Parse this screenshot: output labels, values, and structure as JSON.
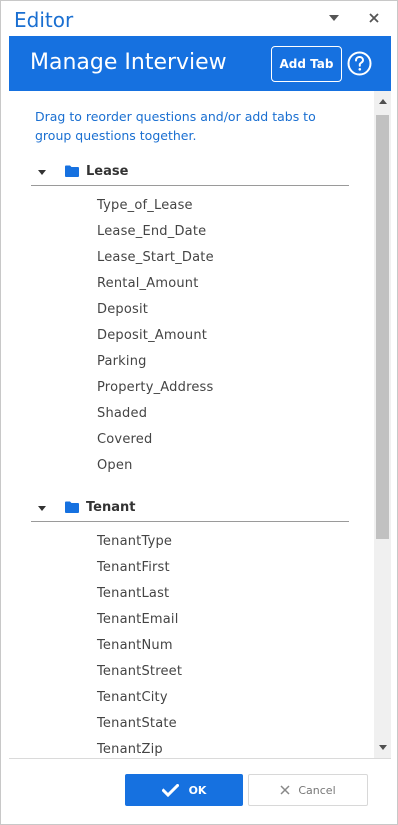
{
  "window": {
    "title": "Editor"
  },
  "header": {
    "title": "Manage Interview",
    "add_tab_label": "Add Tab"
  },
  "instructions": "Drag to reorder questions and/or add tabs to group questions together.",
  "groups": [
    {
      "name": "Lease",
      "items": [
        "Type_of_Lease",
        "Lease_End_Date",
        "Lease_Start_Date",
        "Rental_Amount",
        "Deposit",
        "Deposit_Amount",
        "Parking",
        "Property_Address",
        "Shaded",
        "Covered",
        "Open"
      ]
    },
    {
      "name": "Tenant",
      "items": [
        "TenantType",
        "TenantFirst",
        "TenantLast",
        "TenantEmail",
        "TenantNum",
        "TenantStreet",
        "TenantCity",
        "TenantState",
        "TenantZip"
      ]
    }
  ],
  "footer": {
    "ok_label": "OK",
    "cancel_label": "Cancel"
  },
  "colors": {
    "accent": "#1671e0",
    "title_text": "#1a6fd1"
  },
  "icons": {
    "dropdown": "chevron-down-icon",
    "close": "close-icon",
    "help": "help-circle-icon",
    "folder": "folder-icon",
    "caret": "caret-down-icon",
    "check": "check-icon",
    "cancel": "x-icon"
  }
}
